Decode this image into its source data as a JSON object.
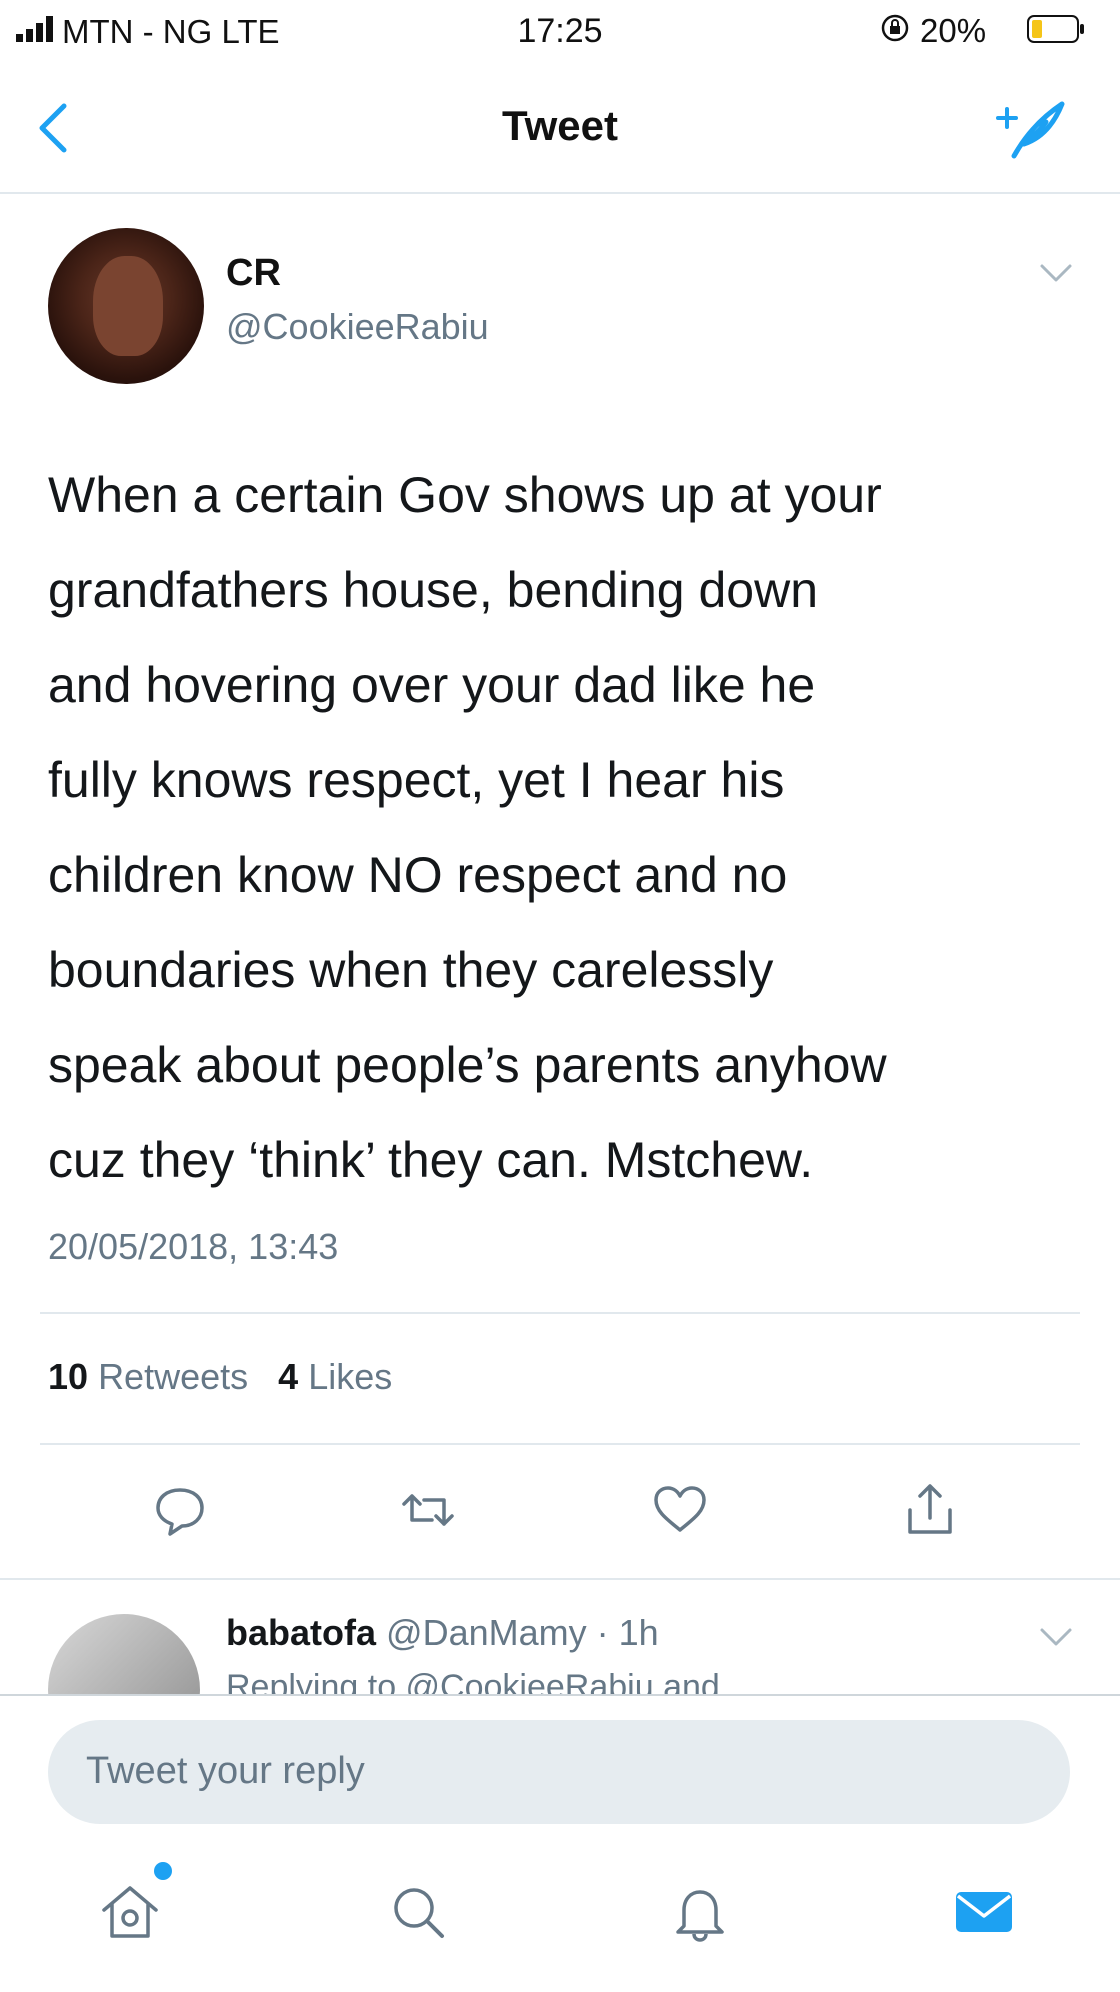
{
  "status_bar": {
    "carrier": "MTN - NG  LTE",
    "time": "17:25",
    "battery": "20%"
  },
  "nav": {
    "title": "Tweet",
    "back_icon": "chevron-left-icon",
    "compose_icon": "compose-tweet-icon"
  },
  "tweet": {
    "name": "CR",
    "handle": "@CookieeRabiu",
    "lines": [
      "When a certain Gov shows up at your",
      "grandfathers house, bending down",
      "and hovering over your dad like he",
      "fully knows respect, yet I hear his",
      "children know NO respect and no",
      "boundaries when they carelessly",
      "speak about people’s parents anyhow",
      "cuz they ‘think’ they can. Mstchew."
    ],
    "timestamp": "20/05/2018, 13:43",
    "retweets_count": "10",
    "retweets_label": "Retweets",
    "likes_count": "4",
    "likes_label": "Likes"
  },
  "reply": {
    "name": "babatofa",
    "meta": "@DanMamy · 1h",
    "replying_to": "Replying to @CookieeRabiu and"
  },
  "reply_box": {
    "placeholder": "Tweet your reply"
  },
  "colors": {
    "accent": "#1da1f2",
    "text": "#14171a",
    "muted": "#657786",
    "divider": "#e1e8ed"
  }
}
